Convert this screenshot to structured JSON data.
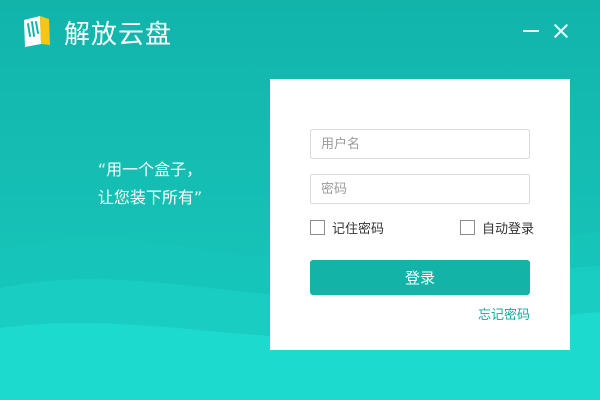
{
  "app": {
    "title": "解放云盘"
  },
  "window_controls": {
    "minimize_icon": "minimize-icon",
    "close_icon": "close-icon"
  },
  "slogan": {
    "line1": "“用一个盒子，",
    "line2": "让您装下所有”"
  },
  "login": {
    "username_placeholder": "用户名",
    "password_placeholder": "密码",
    "remember_password_label": "记住密码",
    "auto_login_label": "自动登录",
    "login_button_label": "登录",
    "forgot_password_label": "忘记密码"
  },
  "colors": {
    "background": "#14b8ad",
    "accent": "#14b3a8",
    "link": "#13aaa0",
    "card": "#ffffff"
  }
}
